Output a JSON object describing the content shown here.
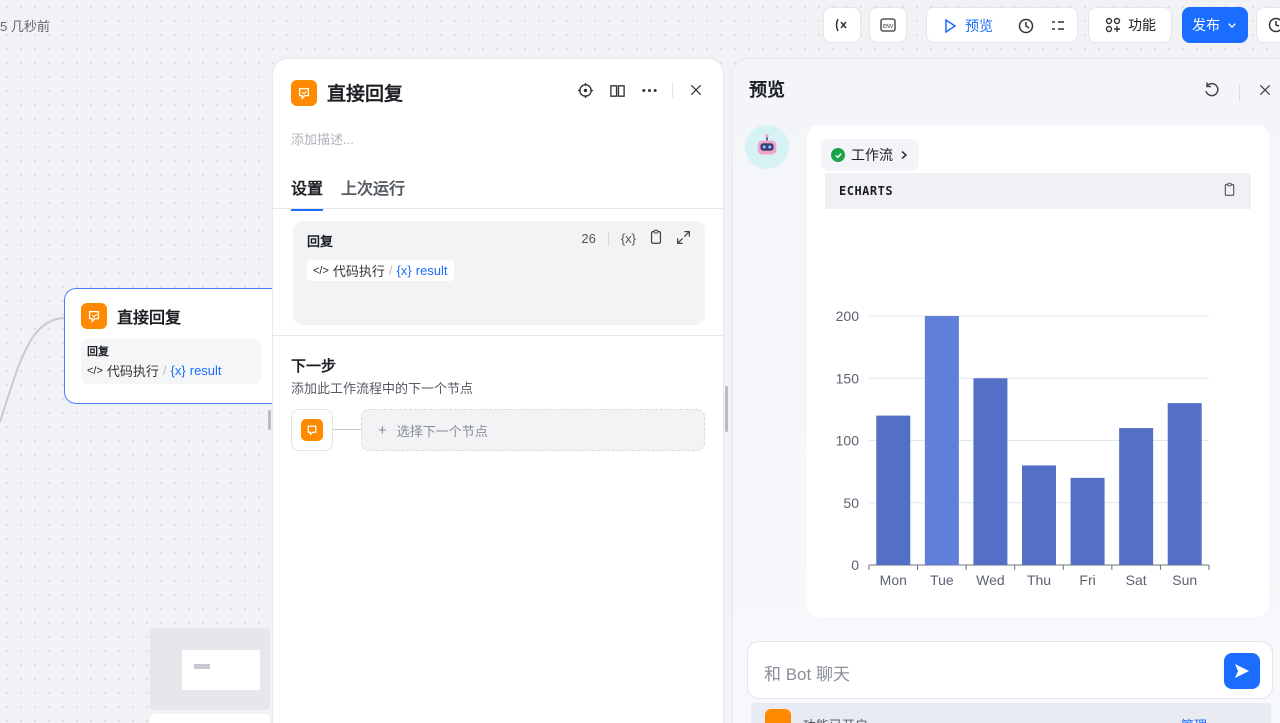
{
  "topbar": {
    "saved_text": "5 几秒前",
    "preview_label": "预览",
    "features_label": "功能",
    "publish_label": "发布"
  },
  "canvas_node": {
    "title": "直接回复",
    "field_label": "回复",
    "ref_code": "代码执行",
    "ref_sep": "/",
    "ref_var": "result"
  },
  "panel": {
    "title": "直接回复",
    "desc_placeholder": "添加描述...",
    "tabs": [
      "设置",
      "上次运行"
    ],
    "reply": {
      "label": "回复",
      "count": "26",
      "var_tool": "{x}",
      "ref_code": "代码执行",
      "ref_sep": "/",
      "ref_var": "result"
    },
    "next": {
      "title": "下一步",
      "desc": "添加此工作流程中的下一个节点",
      "select_label": "选择下一个节点"
    }
  },
  "preview": {
    "title": "预览",
    "workflow_pill": "工作流",
    "code_lang": "ECHARTS",
    "chat_placeholder": "和 Bot 聊天",
    "feature_text": "功能已开启",
    "manage_label": "管理"
  },
  "colors": {
    "accent": "#1a6dff",
    "node_orange": "#ff8a00",
    "bar": "#5470c6",
    "bar_highlight": "#5f7fd9"
  },
  "chart_data": {
    "type": "bar",
    "categories": [
      "Mon",
      "Tue",
      "Wed",
      "Thu",
      "Fri",
      "Sat",
      "Sun"
    ],
    "values": [
      120,
      200,
      150,
      80,
      70,
      110,
      130
    ],
    "ylim": [
      0,
      200
    ],
    "yticks": [
      0,
      50,
      100,
      150,
      200
    ],
    "grid": true
  }
}
